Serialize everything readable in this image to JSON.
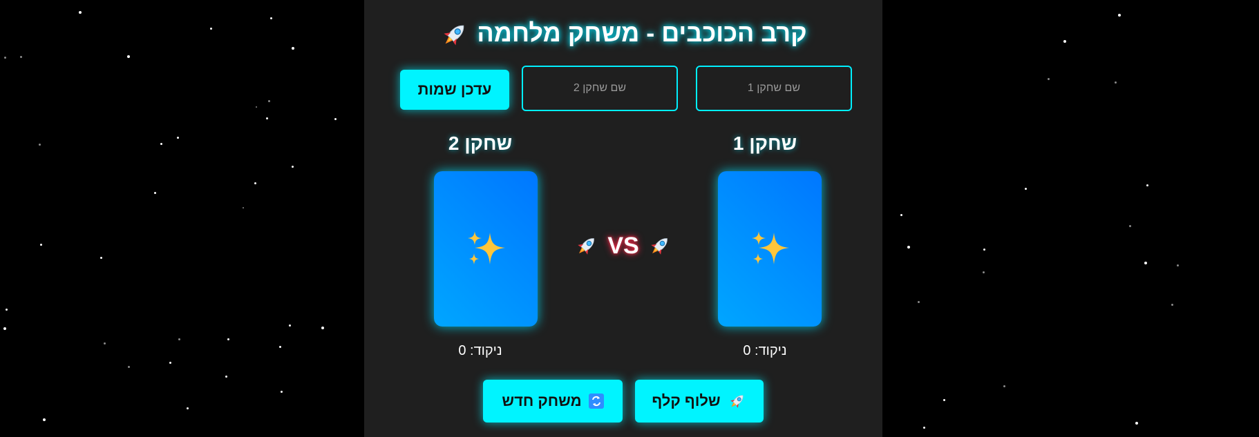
{
  "header": {
    "title": "קרב הכוכבים - משחק מלחמה",
    "title_icon": "rocket-icon"
  },
  "names": {
    "player1_placeholder": "שם שחקן 1",
    "player2_placeholder": "שם שחקן 2",
    "update_label": "עדכן שמות"
  },
  "players": [
    {
      "name": "שחקן 1",
      "score_text": "ניקוד: 0",
      "card_icon": "sparkles-icon"
    },
    {
      "name": "שחקן 2",
      "score_text": "ניקוד: 0",
      "card_icon": "sparkles-icon"
    }
  ],
  "versus": {
    "label": "VS",
    "icon": "rocket-icon"
  },
  "actions": {
    "draw_label": "שלוף קלף",
    "draw_icon": "rocket-icon",
    "new_game_label": "משחק חדש",
    "new_game_icon": "refresh-icon"
  },
  "colors": {
    "accent": "#00f4ff",
    "card": "#0088ff",
    "panel": "#1f1f1f",
    "background": "#000000",
    "vs_glow": "#ff2a4a"
  }
}
